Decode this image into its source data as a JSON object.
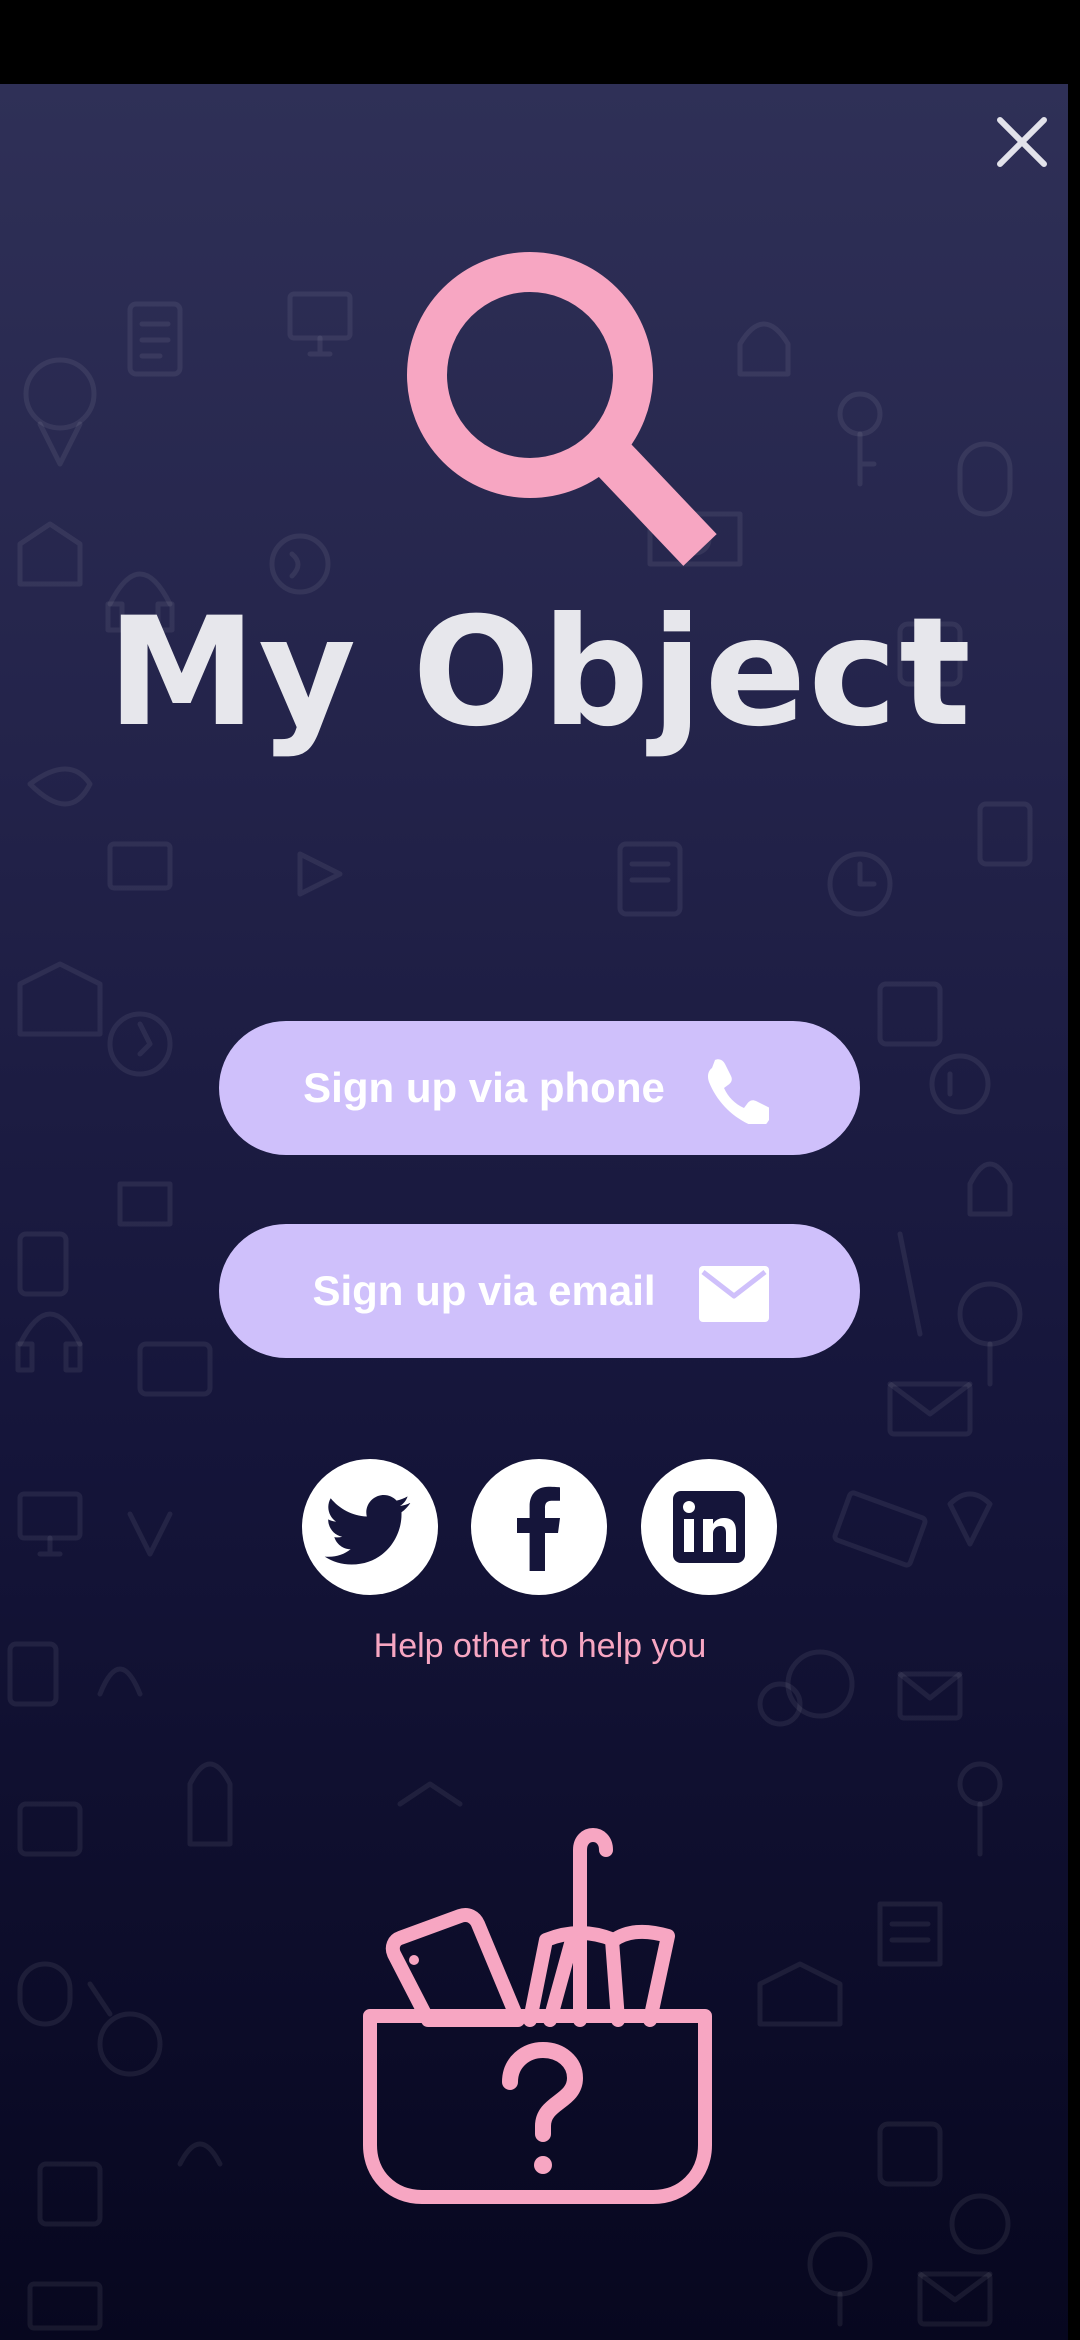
{
  "app": {
    "title": "My Object"
  },
  "buttons": {
    "phone_label": "Sign up via phone",
    "email_label": "Sign up via email"
  },
  "social": {
    "items": [
      {
        "name": "twitter",
        "icon": "twitter-icon"
      },
      {
        "name": "facebook",
        "icon": "facebook-icon"
      },
      {
        "name": "linkedin",
        "icon": "linkedin-icon"
      }
    ]
  },
  "tagline": "Help other to help you",
  "icons": {
    "close": "close-icon",
    "logo": "magnifier-icon",
    "phone": "phone-icon",
    "email": "envelope-icon",
    "illustration": "basket-question-icon"
  },
  "colors": {
    "accent_pink": "#f7a6c2",
    "button_bg": "#cfc0fb",
    "title_text": "#e7e7ec",
    "background_top": "#2f3057",
    "background_bottom": "#07071f",
    "social_icon_fill": "#15153a"
  }
}
